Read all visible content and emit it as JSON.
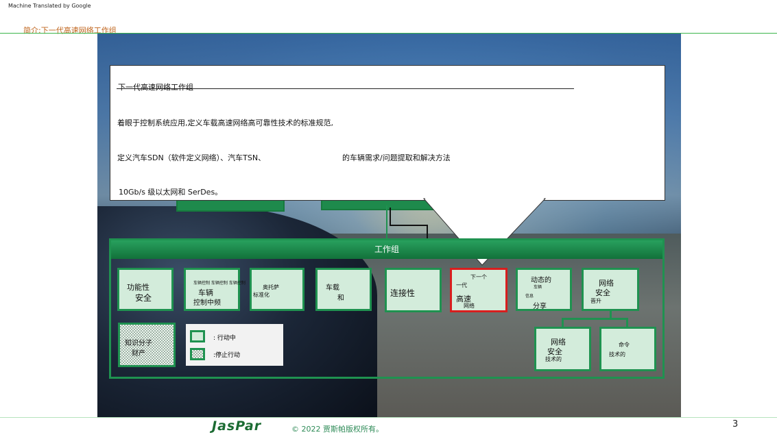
{
  "machine_translated_label": "Machine Translated by Google",
  "section_title": "简介:下一代高速网络工作组",
  "callout": {
    "title": "下一代高速网络工作组",
    "line1": "着眼于控制系统应用,定义车载高速网络高可靠性技术的标准规范,",
    "line2a": "定义汽车SDN（软件定义网络）、汽车TSN、",
    "line2b": "的车辆需求/问题提取和解决方法",
    "line3": "10Gb/s 级以太网和 SerDes。"
  },
  "working_group": {
    "header": "工作组",
    "boxes": [
      {
        "id": "functional-safety",
        "lines": [
          "功能性",
          "安全"
        ]
      },
      {
        "id": "vehicle-control",
        "tiny": "车辆控制 车辆控制 车辆控制",
        "lines": [
          "车辆",
          "控制中频"
        ]
      },
      {
        "id": "autosar",
        "lines": [
          "奥托萨",
          "标准化"
        ]
      },
      {
        "id": "in-vehicle",
        "lines": [
          "车载",
          "和"
        ]
      },
      {
        "id": "connectivity",
        "lines": [
          "连接性"
        ]
      },
      {
        "id": "next-gen-network",
        "lines": [
          "下一个",
          "一代",
          "高速",
          "网络"
        ],
        "highlight": "#d81e1e"
      },
      {
        "id": "dynamic-info",
        "lines": [
          "动态的",
          "车辆",
          "信息",
          "分享"
        ]
      },
      {
        "id": "network-security-upgrade",
        "lines": [
          "网络",
          "安全",
          "晋升"
        ]
      },
      {
        "id": "network-security-tech",
        "lines": [
          "网络",
          "安全",
          "技术的"
        ]
      },
      {
        "id": "command-tech",
        "lines": [
          "命令",
          "技术的"
        ]
      },
      {
        "id": "intellectual-property",
        "lines": [
          "知识分子",
          "财产"
        ]
      }
    ]
  },
  "legend": {
    "active": ": 行动中",
    "stopped": ":停止行动"
  },
  "footer": {
    "logo": "JasPar",
    "copyright": "© 2022 贾斯帕版权所有。",
    "page_number": "3"
  },
  "colors": {
    "accent_green": "#1f9250",
    "box_fill": "#d3ecdb",
    "highlight_red": "#d81e1e",
    "section_title": "#c0651d"
  }
}
